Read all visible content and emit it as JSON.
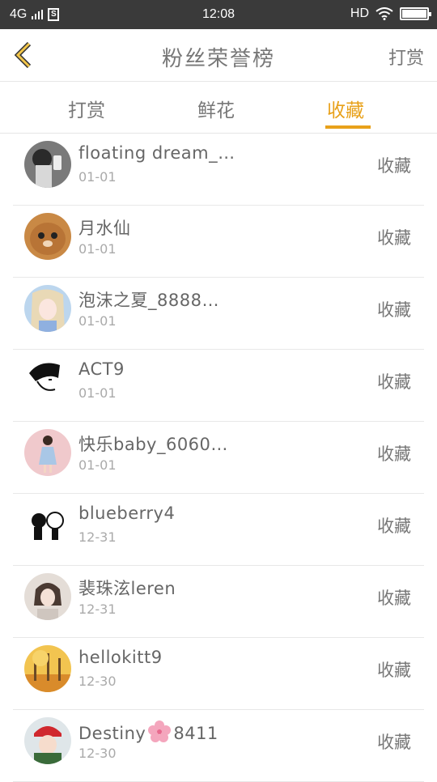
{
  "status_bar": {
    "network": "4G",
    "sim_label": "S",
    "time": "12:08",
    "hd": "HD"
  },
  "header": {
    "title": "粉丝荣誉榜",
    "action_label": "打赏"
  },
  "tabs": [
    {
      "label": "打赏",
      "active": false
    },
    {
      "label": "鲜花",
      "active": false
    },
    {
      "label": "收藏",
      "active": true
    }
  ],
  "rows": [
    {
      "name": "floating dream_…",
      "date": "01-01",
      "action": "收藏"
    },
    {
      "name": "月水仙",
      "date": "01-01",
      "action": "收藏"
    },
    {
      "name": "泡沫之夏_8888…",
      "date": "01-01",
      "action": "收藏"
    },
    {
      "name": "ACT9",
      "date": "01-01",
      "action": "收藏"
    },
    {
      "name": "快乐baby_6060…",
      "date": "01-01",
      "action": "收藏"
    },
    {
      "name": "blueberry4",
      "date": "12-31",
      "action": "收藏"
    },
    {
      "name": "裴珠泫leren",
      "date": "12-31",
      "action": "收藏"
    },
    {
      "name": "hellokitt9",
      "date": "12-30",
      "action": "收藏"
    },
    {
      "name": "Destiny",
      "name_suffix": "8411",
      "date": "12-30",
      "action": "收藏"
    }
  ],
  "colors": {
    "accent": "#e8a11a",
    "status_bar": "#3a3a3a"
  }
}
